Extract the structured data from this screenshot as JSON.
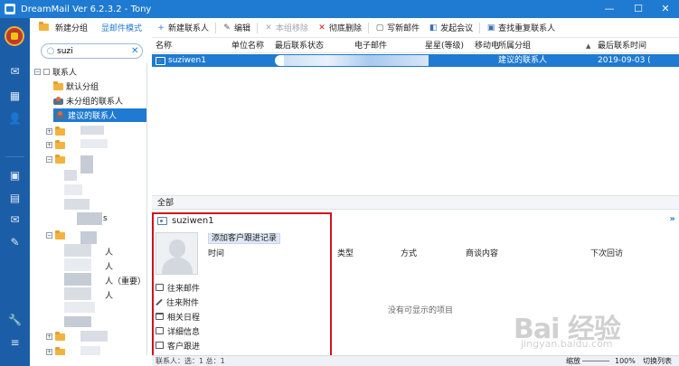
{
  "window": {
    "title": "DreamMail Ver 6.2.3.2  -  Tony",
    "minimize_glyph": "—",
    "maximize_glyph": "☐",
    "close_glyph": "✕"
  },
  "left_panel": {
    "new_group_label": "新建分组",
    "mode_label": "显邮件模式",
    "search_value": "suzi",
    "search_clear_glyph": "✕"
  },
  "tree": {
    "root_label": "联系人",
    "items": [
      {
        "label": "默认分组",
        "icon": "folder-icon"
      },
      {
        "label": "未分组的联系人",
        "icon": "group-icon"
      },
      {
        "label": "建议的联系人",
        "icon": "group-icon",
        "selected": true
      }
    ],
    "blurred_fragments": [
      "s",
      "人",
      "人",
      "人（重要）",
      "人"
    ]
  },
  "toolbar": {
    "buttons": [
      {
        "label": "新建联系人",
        "icon": "add-contact-icon",
        "enabled": true
      },
      {
        "label": "编辑",
        "icon": "edit-icon",
        "enabled": true
      },
      {
        "label": "本组移除",
        "icon": "remove-icon",
        "enabled": false
      },
      {
        "label": "彻底删除",
        "icon": "delete-icon",
        "enabled": true
      },
      {
        "label": "写新邮件",
        "icon": "compose-icon",
        "enabled": true
      },
      {
        "label": "发起会议",
        "icon": "meeting-icon",
        "enabled": true
      },
      {
        "label": "查找重复联系人",
        "icon": "find-duplicates-icon",
        "enabled": true
      }
    ]
  },
  "grid": {
    "columns": [
      "名称",
      "单位名称",
      "最后联系状态",
      "电子邮件",
      "星星(等级)",
      "移动电",
      "所属分组",
      "最后联系时间"
    ],
    "sort_indicator": "▲",
    "rows": [
      {
        "name": "suziwen1",
        "group": "建议的联系人",
        "last_contact": "2019-09-03 ("
      }
    ]
  },
  "tabs": {
    "all_label": "全部"
  },
  "detail": {
    "contact_name": "suziwen1",
    "collapse_glyph": "»",
    "add_record_label": "添加客户跟进记录",
    "columns": [
      "时间",
      "类型",
      "方式",
      "商谈内容",
      "下次回访"
    ],
    "empty_message": "没有可显示的项目",
    "menu": [
      "往来邮件",
      "往来附件",
      "相关日程",
      "详细信息",
      "客户跟进"
    ]
  },
  "status_bar": {
    "count_text": "联系人：选：1 总：1",
    "zoom_label": "缩放",
    "zoom_percent": "100%",
    "toggle_label": "切换列表"
  },
  "watermark": {
    "logo_text": "Bai 经验",
    "url": "jingyan.baidu.com"
  }
}
